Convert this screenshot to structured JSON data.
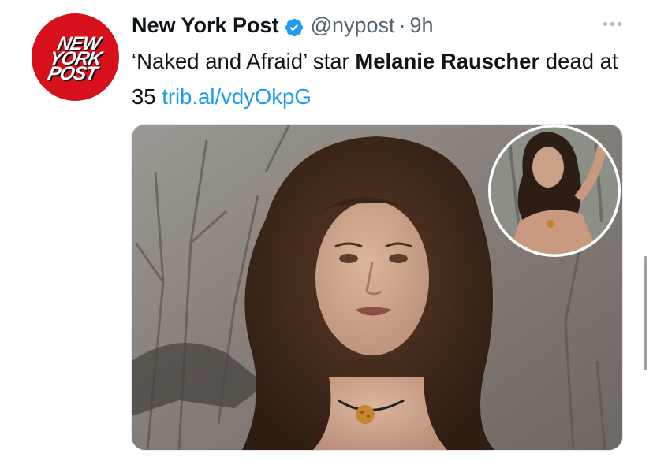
{
  "tweet": {
    "author": {
      "name": "New York Post",
      "handle": "@nypost",
      "separator": "·",
      "time": "9h",
      "logo_lines": [
        "NEW",
        "YORK",
        "POST"
      ],
      "avatar_color": "#d6111c"
    },
    "text_pre": "‘Naked and Afraid’ star ",
    "text_bold": "Melanie Rauscher",
    "text_post": " dead at 35 ",
    "link": "trib.al/vdyOkpG",
    "link_color": "#1d9bf0",
    "icons": [
      "verified-badge-icon",
      "more-options-icon"
    ]
  }
}
